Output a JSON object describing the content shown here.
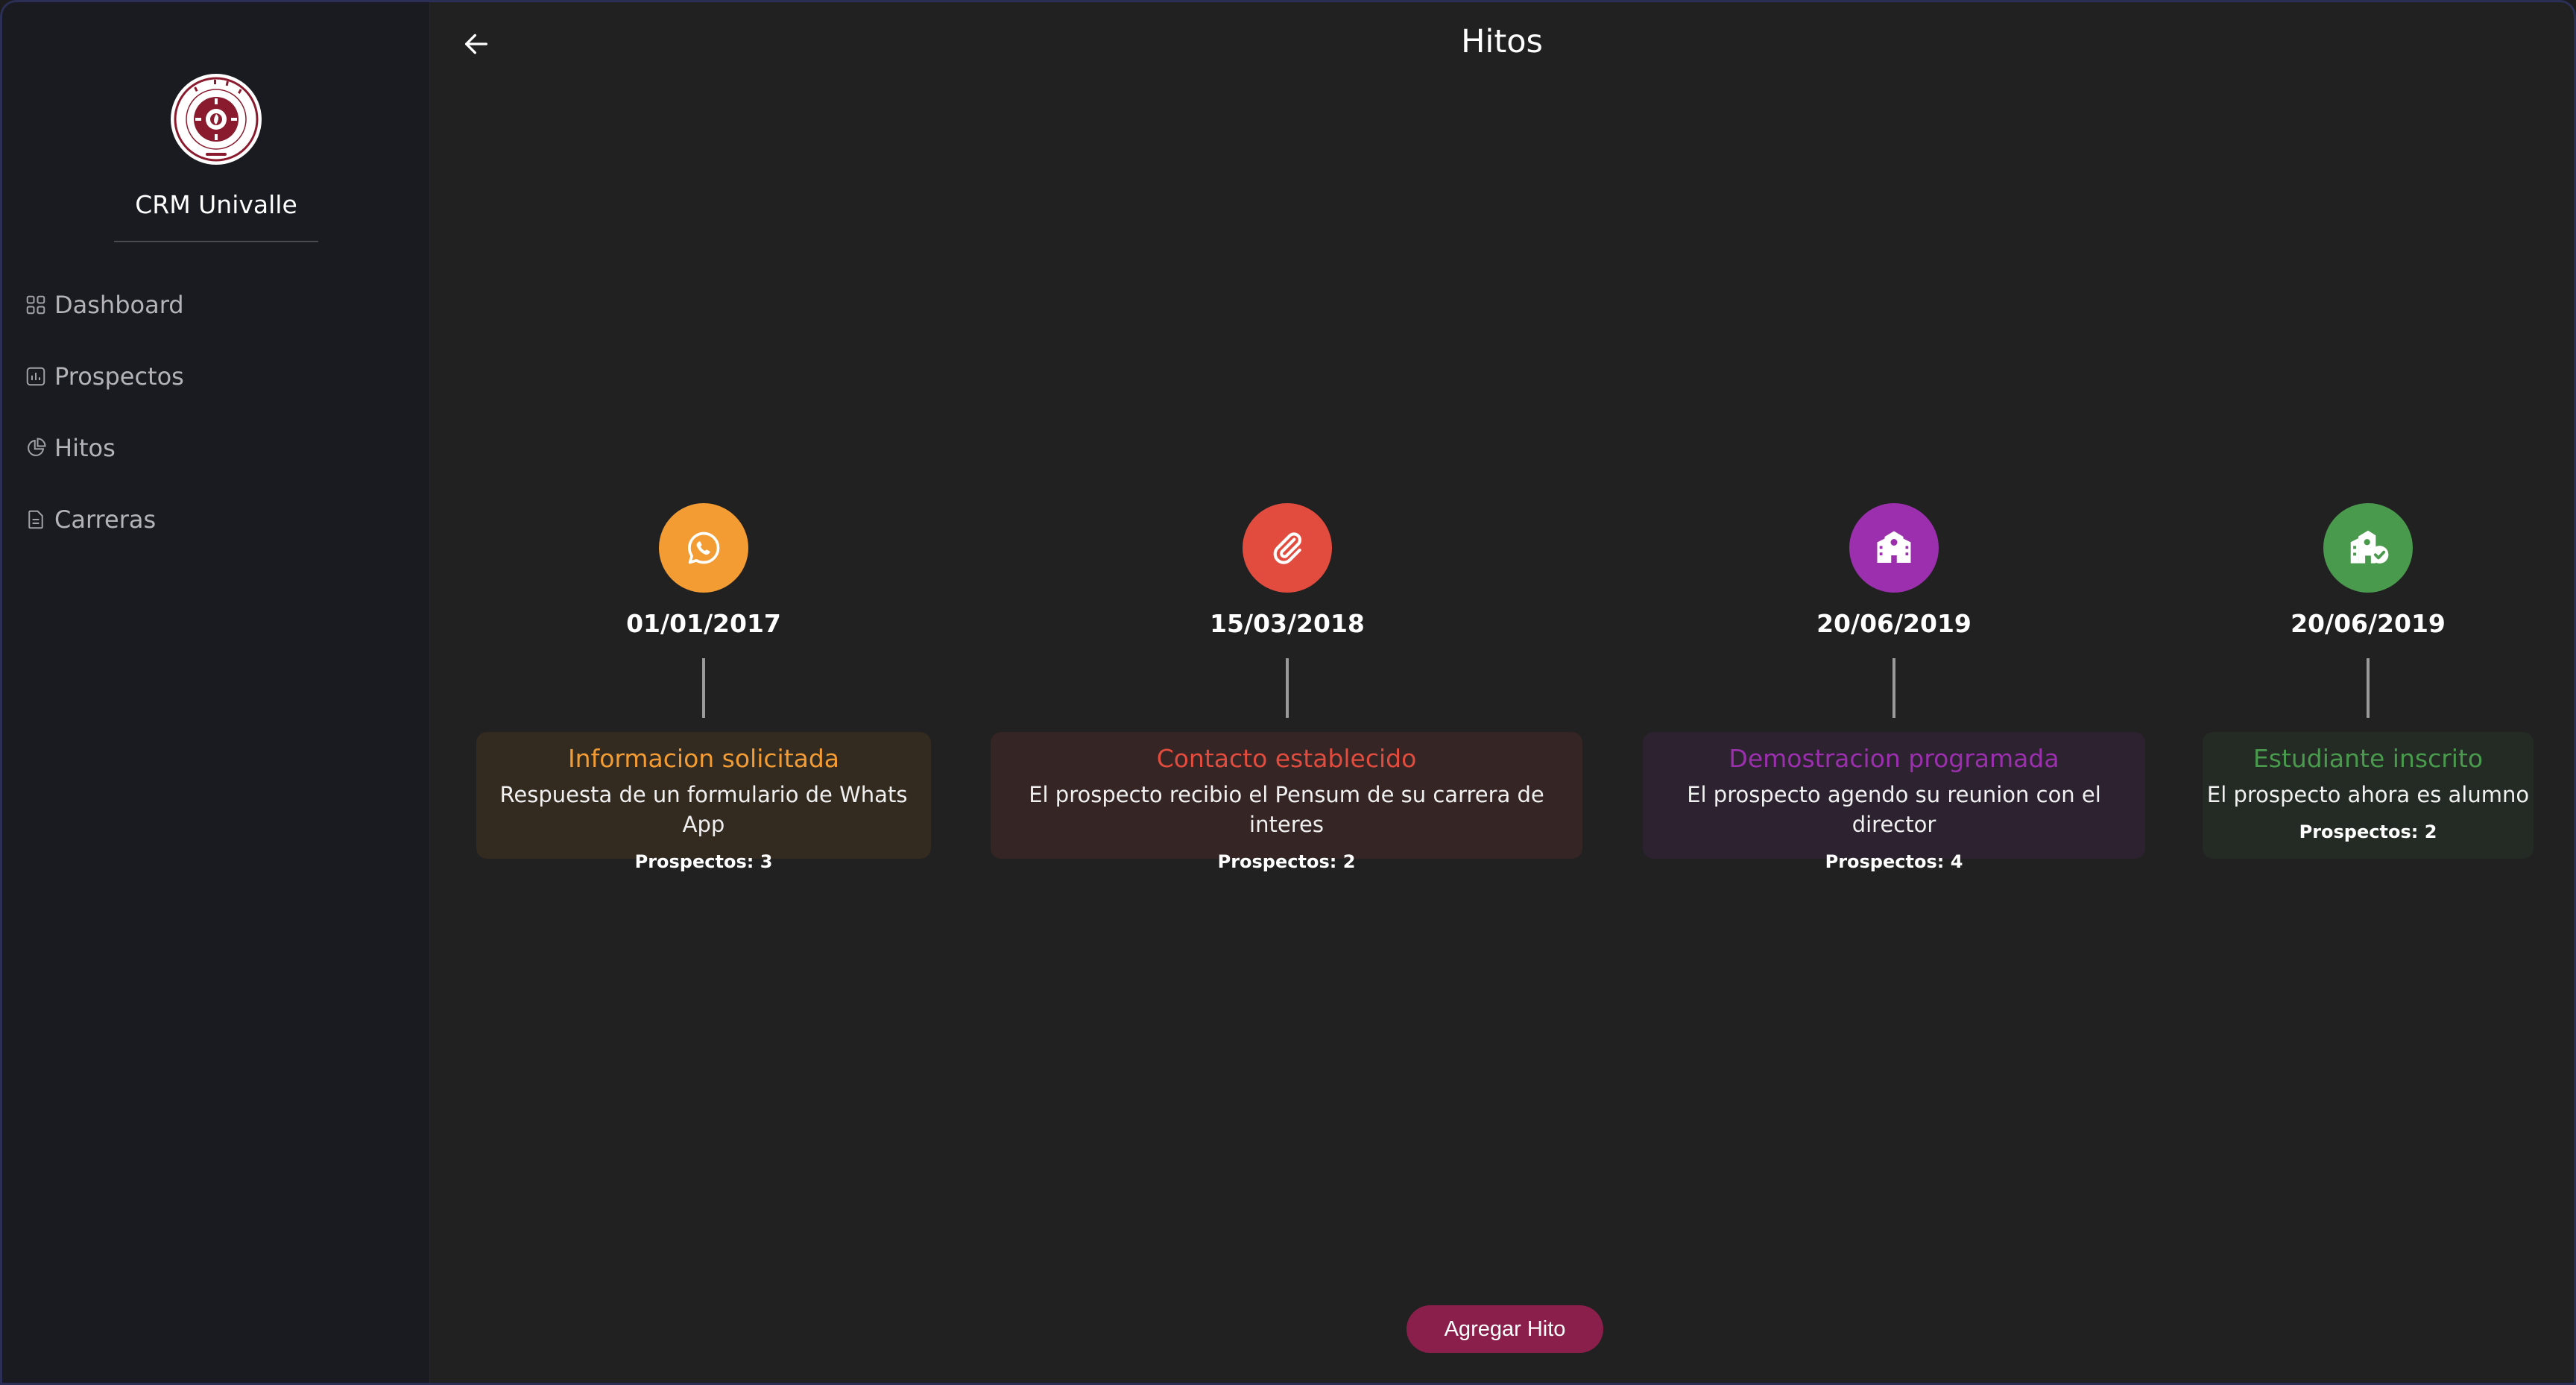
{
  "sidebar": {
    "logo_name": "univalle-seal",
    "logo_text": "UNIVERSIDAD DEL VALLE · BOLIVIA",
    "brand": "CRM Univalle",
    "items": [
      {
        "label": "Dashboard",
        "icon": "grid-icon"
      },
      {
        "label": "Prospectos",
        "icon": "chart-icon"
      },
      {
        "label": "Hitos",
        "icon": "pie-icon"
      },
      {
        "label": "Carreras",
        "icon": "document-icon"
      }
    ]
  },
  "header": {
    "title": "Hitos",
    "back_icon": "arrow-left-icon"
  },
  "milestones": [
    {
      "date": "01/01/2017",
      "title": "Informacion solicitada",
      "description": "Respuesta de un formulario de Whats App",
      "count": "Prospectos: 3",
      "color": "#f39c33",
      "card_bg": "#332a20",
      "icon": "whatsapp-icon"
    },
    {
      "date": "15/03/2018",
      "title": "Contacto establecido",
      "description": "El prospecto recibio el Pensum de su carrera de interes",
      "count": "Prospectos: 2",
      "color": "#e24c3f",
      "card_bg": "#352524",
      "icon": "paperclip-icon"
    },
    {
      "date": "20/06/2019",
      "title": "Demostracion programada",
      "description": "El prospecto agendo su reunion con el director",
      "count": "Prospectos: 4",
      "color": "#9b2fae",
      "card_bg": "#2c2230",
      "icon": "school-icon"
    },
    {
      "date": "20/06/2019",
      "title": "Estudiante inscrito",
      "description": "El prospecto ahora es alumno",
      "count": "Prospectos: 2",
      "color": "#4a9a4e",
      "card_bg": "#232b24",
      "icon": "enrolled-icon"
    }
  ],
  "actions": {
    "add_label": "Agregar Hito"
  }
}
